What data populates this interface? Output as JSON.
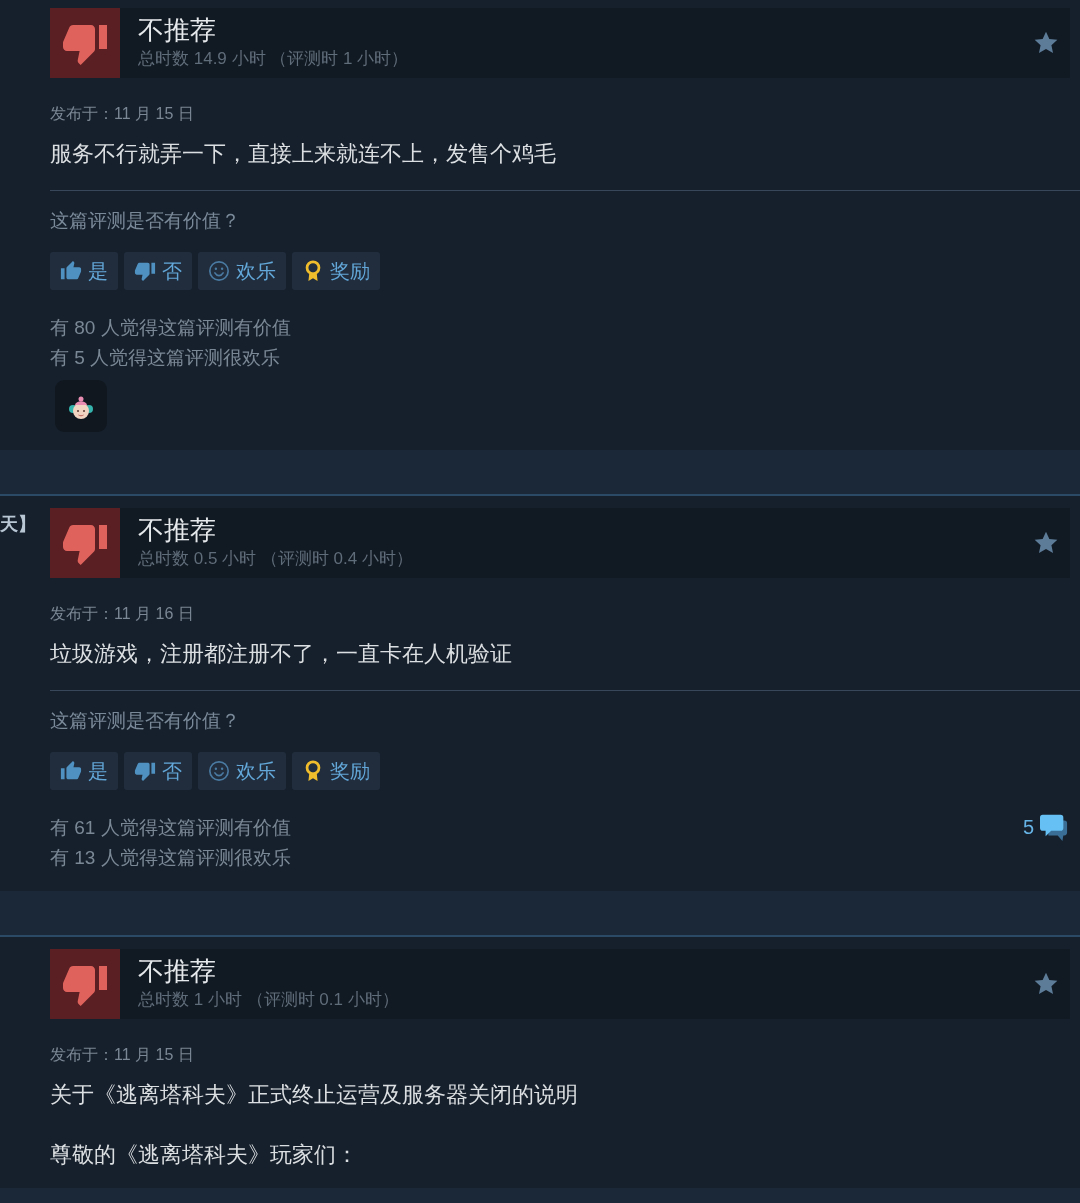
{
  "reviews": [
    {
      "rating": {
        "label": "不推荐",
        "recommended": false
      },
      "playtime": "总时数 14.9 小时 （评测时 1 小时）",
      "posted": "发布于：11 月 15 日",
      "body": [
        "服务不行就弄一下，直接上来就连不上，发售个鸡毛"
      ],
      "helpful": {
        "prompt": "这篇评测是否有价值？",
        "buttons": [
          {
            "kind": "yes",
            "label": "是"
          },
          {
            "kind": "no",
            "label": "否"
          },
          {
            "kind": "funny",
            "label": "欢乐"
          },
          {
            "kind": "award",
            "label": "奖励"
          }
        ],
        "stats": [
          "有 80 人觉得这篇评测有价值",
          "有 5 人觉得这篇评测很欢乐"
        ]
      },
      "award_shown": true
    },
    {
      "side_text": "天】",
      "rating": {
        "label": "不推荐",
        "recommended": false
      },
      "playtime": "总时数 0.5 小时 （评测时 0.4 小时）",
      "posted": "发布于：11 月 16 日",
      "body": [
        "垃圾游戏，注册都注册不了，一直卡在人机验证"
      ],
      "helpful": {
        "prompt": "这篇评测是否有价值？",
        "buttons": [
          {
            "kind": "yes",
            "label": "是"
          },
          {
            "kind": "no",
            "label": "否"
          },
          {
            "kind": "funny",
            "label": "欢乐"
          },
          {
            "kind": "award",
            "label": "奖励"
          }
        ],
        "stats": [
          "有 61 人觉得这篇评测有价值",
          "有 13 人觉得这篇评测很欢乐"
        ]
      },
      "comments": "5",
      "award_shown": false
    },
    {
      "rating": {
        "label": "不推荐",
        "recommended": false
      },
      "playtime": "总时数 1 小时 （评测时 0.1 小时）",
      "posted": "发布于：11 月 15 日",
      "body": [
        "关于《逃离塔科夫》正式终止运营及服务器关闭的说明",
        "尊敬的《逃离塔科夫》玩家们："
      ]
    }
  ]
}
